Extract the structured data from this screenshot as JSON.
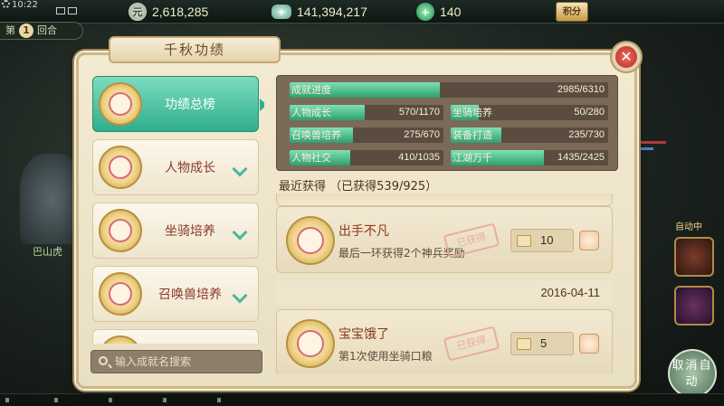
{
  "status": {
    "time": "10:22"
  },
  "currencies": [
    {
      "name": "silver-coin",
      "icon_char": "元",
      "value": "2,618,285"
    },
    {
      "name": "ingot",
      "icon_char": "",
      "value": "141,394,217"
    },
    {
      "name": "jade",
      "icon_char": "",
      "value": "140"
    }
  ],
  "score_button": {
    "label": "积分"
  },
  "round": {
    "prefix": "第",
    "number": "1",
    "suffix": "回合"
  },
  "background": {
    "npc_name": "巴山虎",
    "auto_label": "自动中",
    "cancel_auto_label": "取消自动"
  },
  "panel": {
    "title": "千秋功绩"
  },
  "categories": [
    {
      "label": "功绩总榜",
      "active": true
    },
    {
      "label": "人物成长",
      "active": false
    },
    {
      "label": "坐骑培养",
      "active": false
    },
    {
      "label": "召唤兽培养",
      "active": false
    }
  ],
  "search": {
    "placeholder": "输入成就名搜索"
  },
  "progress": {
    "overall": {
      "label": "成就进度",
      "value": "2985/6310",
      "fraction": 0.473
    },
    "items": [
      {
        "label": "人物成长",
        "value": "570/1170",
        "fraction": 0.487
      },
      {
        "label": "坐骑培养",
        "value": "50/280",
        "fraction": 0.179
      },
      {
        "label": "召唤兽培养",
        "value": "275/670",
        "fraction": 0.41
      },
      {
        "label": "装备打造",
        "value": "235/730",
        "fraction": 0.322
      },
      {
        "label": "人物社交",
        "value": "410/1035",
        "fraction": 0.396
      },
      {
        "label": "江湖万千",
        "value": "1435/2425",
        "fraction": 0.592
      }
    ]
  },
  "recent": {
    "title": "最近获得",
    "count": "（已获得539/925）"
  },
  "achievements": [
    {
      "title": "出手不凡",
      "desc": "最后一环获得2个神兵奖励",
      "stamp": "已获得",
      "reward": "10"
    },
    {
      "title": "宝宝饿了",
      "desc": "第1次使用坐骑口粮",
      "stamp": "已获得",
      "reward": "5"
    }
  ],
  "date_divider": "2016-04-11"
}
